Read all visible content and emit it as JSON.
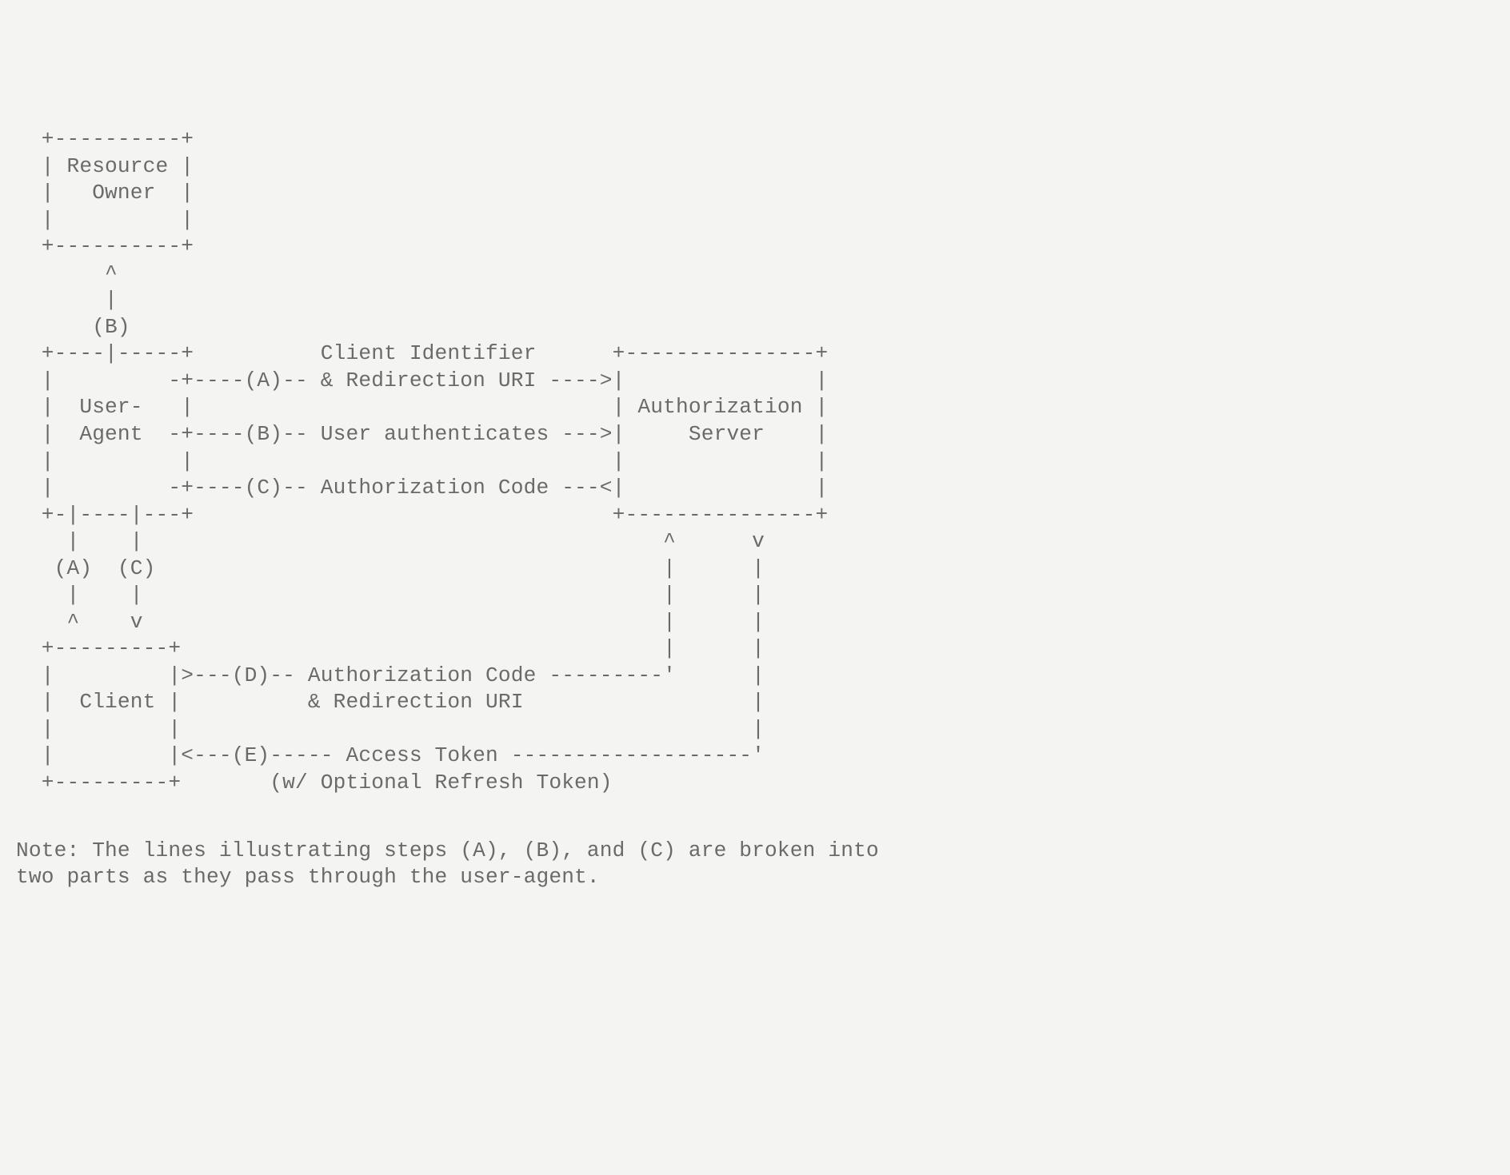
{
  "diagram": {
    "lines": [
      "  +----------+",
      "  | Resource |",
      "  |   Owner  |",
      "  |          |",
      "  +----------+",
      "       ^",
      "       |",
      "      (B)",
      "  +----|-----+          Client Identifier      +---------------+",
      "  |         -+----(A)-- & Redirection URI ---->|               |",
      "  |  User-   |                                 | Authorization |",
      "  |  Agent  -+----(B)-- User authenticates --->|     Server    |",
      "  |          |                                 |               |",
      "  |         -+----(C)-- Authorization Code ---<|               |",
      "  +-|----|---+                                 +---------------+",
      "    |    |                                         ^      v",
      "   (A)  (C)                                        |      |",
      "    |    |                                         |      |",
      "    ^    v                                         |      |",
      "  +---------+                                      |      |",
      "  |         |>---(D)-- Authorization Code ---------'      |",
      "  |  Client |          & Redirection URI                  |",
      "  |         |                                             |",
      "  |         |<---(E)----- Access Token -------------------'",
      "  +---------+       (w/ Optional Refresh Token)"
    ],
    "entities": {
      "resource_owner": "Resource Owner",
      "user_agent": "User-Agent",
      "authorization_server": "Authorization Server",
      "client": "Client"
    },
    "steps": {
      "A": "Client Identifier & Redirection URI",
      "B": "User authenticates",
      "C": "Authorization Code",
      "D": "Authorization Code & Redirection URI",
      "E": "Access Token (w/ Optional Refresh Token)"
    }
  },
  "note_lines": [
    "Note: The lines illustrating steps (A), (B), and (C) are broken into",
    "two parts as they pass through the user-agent."
  ]
}
